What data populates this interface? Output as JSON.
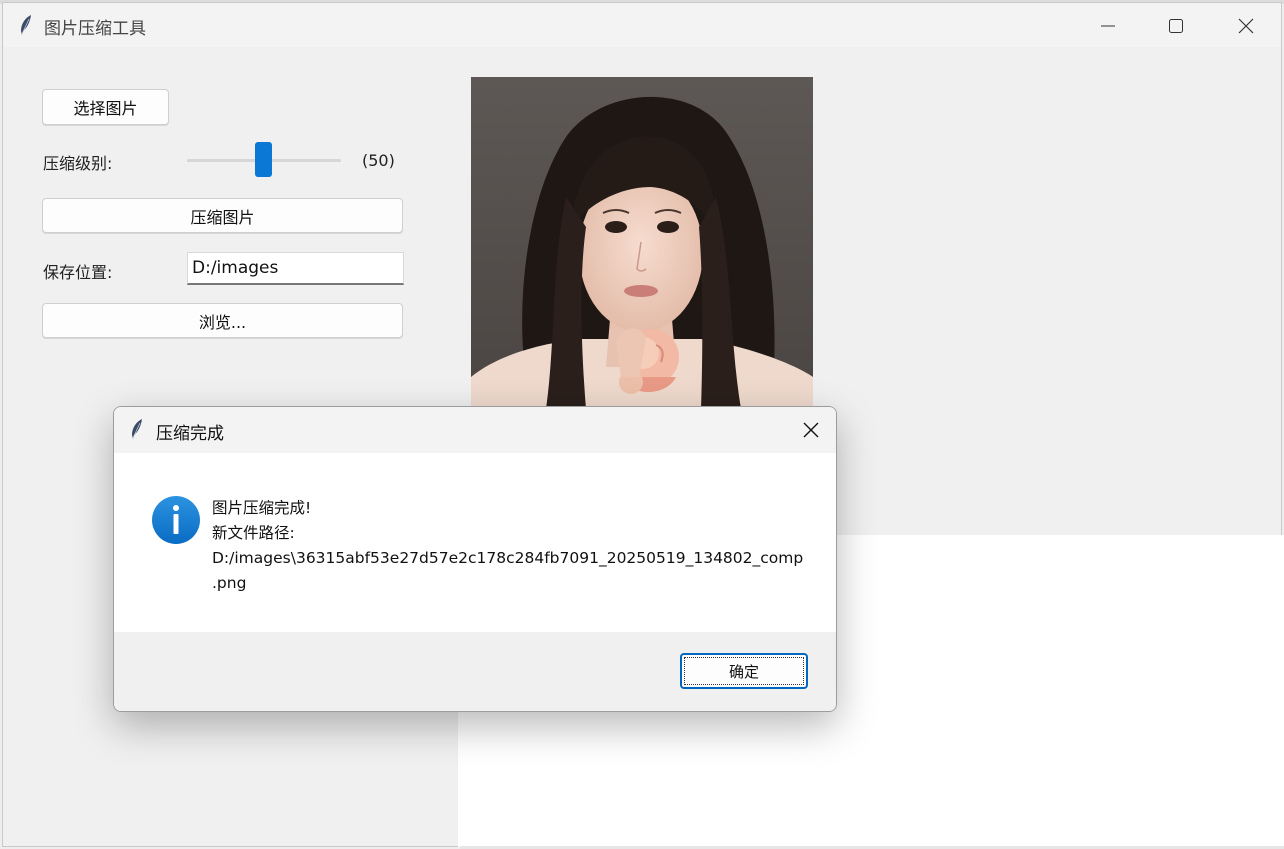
{
  "window": {
    "title": "图片压缩工具",
    "icon": "feather-icon"
  },
  "controls": {
    "select_button": "选择图片",
    "level_label": "压缩级别:",
    "level_value": 50,
    "level_display": "(50)",
    "compress_button": "压缩图片",
    "save_label": "保存位置:",
    "save_path": "D:/images",
    "browse_button": "浏览..."
  },
  "preview": {
    "icon": "image-preview"
  },
  "dialog": {
    "title": "压缩完成",
    "icon": "info-icon",
    "message_line1": "图片压缩完成!",
    "message_line2": "新文件路径:",
    "message_line3": "D:/images\\36315abf53e27d57e2c178c284fb7091_20250519_134802_comp",
    "message_line4": ".png",
    "ok_button": "确定"
  },
  "colors": {
    "accent": "#0a78d4",
    "info_icon": "#1a82d6"
  }
}
